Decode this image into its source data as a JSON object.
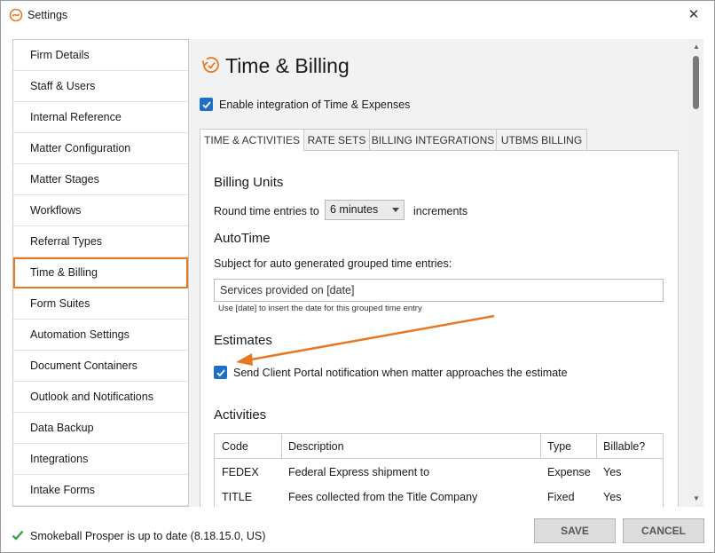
{
  "window": {
    "title": "Settings",
    "close_glyph": "✕"
  },
  "sidebar": {
    "items": [
      {
        "label": "Firm Details"
      },
      {
        "label": "Staff & Users"
      },
      {
        "label": "Internal Reference"
      },
      {
        "label": "Matter Configuration"
      },
      {
        "label": "Matter Stages"
      },
      {
        "label": "Workflows"
      },
      {
        "label": "Referral Types"
      },
      {
        "label": "Time & Billing",
        "active": true
      },
      {
        "label": "Form Suites"
      },
      {
        "label": "Automation Settings"
      },
      {
        "label": "Document Containers"
      },
      {
        "label": "Outlook and Notifications"
      },
      {
        "label": "Data Backup"
      },
      {
        "label": "Integrations"
      },
      {
        "label": "Intake Forms"
      }
    ]
  },
  "page": {
    "title": "Time & Billing",
    "enable_integration": {
      "label": "Enable integration of Time & Expenses",
      "checked": true
    }
  },
  "tabs": [
    {
      "label": "TIME & ACTIVITIES",
      "active": true
    },
    {
      "label": "RATE SETS"
    },
    {
      "label": "BILLING INTEGRATIONS"
    },
    {
      "label": "UTBMS BILLING"
    }
  ],
  "billing_units": {
    "title": "Billing Units",
    "prefix": "Round time entries to",
    "value": "6 minutes",
    "suffix": "increments"
  },
  "autotime": {
    "title": "AutoTime",
    "subject_label": "Subject for auto generated grouped time entries:",
    "subject_value": "Services provided on [date]",
    "hint": "Use [date] to insert the date for this grouped time entry"
  },
  "estimates": {
    "title": "Estimates",
    "notify_label": "Send Client Portal notification when matter approaches the estimate",
    "notify_checked": true
  },
  "activities": {
    "title": "Activities",
    "columns": [
      "Code",
      "Description",
      "Type",
      "Billable?"
    ],
    "rows": [
      [
        "FEDEX",
        "Federal Express shipment to",
        "Expense",
        "Yes"
      ],
      [
        "TITLE",
        "Fees collected from the Title Company",
        "Fixed",
        "Yes"
      ]
    ]
  },
  "footer": {
    "status": "Smokeball Prosper is up to date (8.18.15.0, US)",
    "save_label": "SAVE",
    "cancel_label": "CANCEL"
  },
  "colors": {
    "accent_orange": "#e87722",
    "checkbox_blue": "#1e6fc8",
    "status_green": "#2e9e3a"
  },
  "icons": {
    "app": "smokeball-logo-icon",
    "page": "time-billing-clock-icon",
    "status": "checkmark-icon",
    "close": "close-icon"
  }
}
